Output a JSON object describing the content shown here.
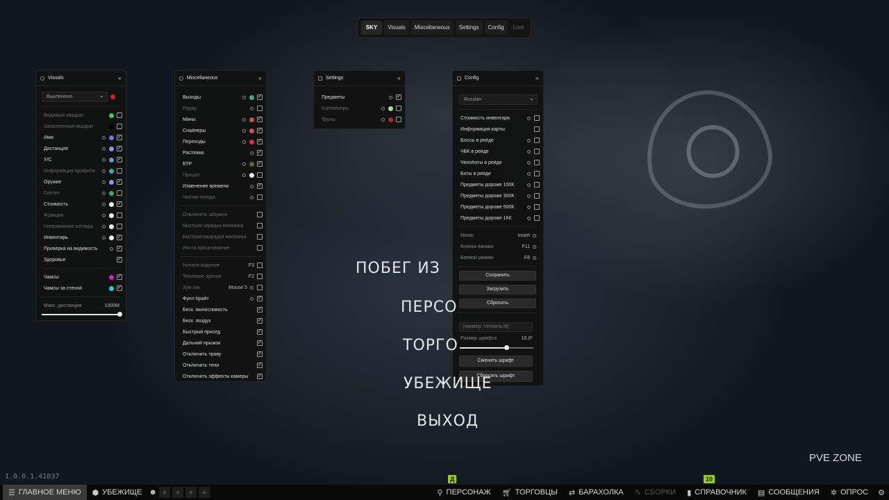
{
  "topnav": {
    "tabs": [
      {
        "label": "SKY"
      },
      {
        "label": "Visuals"
      },
      {
        "label": "Miscellaneous"
      },
      {
        "label": "Settings"
      },
      {
        "label": "Config"
      },
      {
        "label": "Loot"
      }
    ]
  },
  "visuals": {
    "title": "Visuals",
    "close": "×",
    "mode_select": "Выключено",
    "mode_color": "#e02020",
    "rows": [
      {
        "label": "Видимый квадрат",
        "dim": true,
        "color": "#3ccf4e",
        "checked": false
      },
      {
        "label": "Заполненный квадрат",
        "dim": true,
        "color": "#050505",
        "checked": false
      },
      {
        "label": "Имя",
        "dim": false,
        "color": "#7a6cf0",
        "checked": true
      },
      {
        "label": "Дистанция",
        "dim": false,
        "color": "#9a8cf0",
        "checked": true
      },
      {
        "label": "У/С",
        "dim": false,
        "color": "#5a9ae0",
        "checked": true
      },
      {
        "label": "Информация профиля",
        "dim": true,
        "color": "#3aaacc",
        "checked": false
      },
      {
        "label": "Оружие",
        "dim": false,
        "color": "#9a8cf0",
        "checked": true
      },
      {
        "label": "Скелет",
        "dim": true,
        "color": "#3aaa6a",
        "checked": false
      },
      {
        "label": "Стоимость",
        "dim": false,
        "color": "#f0f0f0",
        "checked": true
      },
      {
        "label": "Фракция",
        "dim": true,
        "color": "#f0f0f0",
        "checked": false
      },
      {
        "label": "Направление взгляда",
        "dim": true,
        "color": "#f0f0f0",
        "checked": false
      },
      {
        "label": "Инвентарь",
        "dim": false,
        "color": "#f0f0f0",
        "checked": true
      },
      {
        "label": "Проверка на видимость",
        "dim": false,
        "color": "",
        "checked": true
      },
      {
        "label": "Здоровье",
        "dim": false,
        "color": "",
        "checked": true
      }
    ],
    "rows2": [
      {
        "label": "Чамсы",
        "dim": false,
        "color": "#d020d0",
        "checked": true
      },
      {
        "label": "Чамсы за стеной",
        "dim": false,
        "color": "#20d0e0",
        "checked": true
      }
    ],
    "max_distance_label": "Макс. дистанция",
    "max_distance_value": "1000M",
    "max_distance_fraction": 1.0
  },
  "misc": {
    "title": "Miscellaneous",
    "close": "×",
    "rows": [
      {
        "label": "Выходы",
        "dim": false,
        "color": "#3ab08a",
        "checked": true,
        "key": ""
      },
      {
        "label": "Радар",
        "dim": true,
        "color": "",
        "checked": false,
        "key": ""
      },
      {
        "label": "Мины",
        "dim": false,
        "color": "#d05050",
        "checked": true,
        "key": ""
      },
      {
        "label": "Снайперы",
        "dim": false,
        "color": "#d05060",
        "checked": true,
        "key": ""
      },
      {
        "label": "Переходы",
        "dim": false,
        "color": "#e03040",
        "checked": true,
        "key": ""
      },
      {
        "label": "Растяжки",
        "dim": false,
        "color": "",
        "checked": true,
        "key": ""
      },
      {
        "label": "БТР",
        "dim": false,
        "color": "#5a6a30",
        "checked": true,
        "key": ""
      },
      {
        "label": "Прицел",
        "dim": true,
        "color": "#f8f8f8",
        "checked": false,
        "key": ""
      },
      {
        "label": "Изменение времени",
        "dim": false,
        "color": "",
        "checked": true,
        "key": ""
      },
      {
        "label": "Чистая погода",
        "dim": true,
        "color": "",
        "checked": false,
        "key": ""
      }
    ],
    "rows2": [
      {
        "label": "Отключить забрало",
        "dim": true,
        "checked": false,
        "key": ""
      },
      {
        "label": "Быстрая зарядка магазина",
        "dim": true,
        "checked": false,
        "key": ""
      },
      {
        "label": "Быстрая разрядка магазина",
        "dim": true,
        "checked": false,
        "key": ""
      },
      {
        "label": "Инста прицеливание",
        "dim": true,
        "checked": false,
        "key": ""
      }
    ],
    "rows3": [
      {
        "label": "Ночное видение",
        "dim": true,
        "checked": false,
        "key": "F3",
        "gear": false
      },
      {
        "label": "Тепловое зрение",
        "dim": true,
        "checked": false,
        "key": "F2",
        "gear": false
      },
      {
        "label": "Зум хак",
        "dim": true,
        "checked": false,
        "key": "Mouse 5",
        "gear": true
      },
      {
        "label": "Фулл брайт",
        "dim": false,
        "checked": true,
        "key": "",
        "gear": true
      },
      {
        "label": "Беск. выносливость",
        "dim": false,
        "checked": true,
        "key": "",
        "gear": false
      },
      {
        "label": "Беск. воздух",
        "dim": false,
        "checked": true,
        "key": "",
        "gear": false
      },
      {
        "label": "Быстрый присед",
        "dim": false,
        "checked": true,
        "key": "",
        "gear": false
      },
      {
        "label": "Дальний прыжок",
        "dim": false,
        "checked": true,
        "key": "",
        "gear": false
      },
      {
        "label": "Отключить траву",
        "dim": false,
        "checked": true,
        "key": "",
        "gear": false
      },
      {
        "label": "Отключить тени",
        "dim": false,
        "checked": true,
        "key": "",
        "gear": false
      },
      {
        "label": "Отключить эффекты камеры",
        "dim": false,
        "checked": true,
        "key": "",
        "gear": false
      }
    ]
  },
  "settings": {
    "title": "Settings",
    "close": "×",
    "rows": [
      {
        "label": "Предметы",
        "dim": false,
        "color": "",
        "checked": true
      },
      {
        "label": "Контейнеры",
        "dim": true,
        "color": "#a0e0a0",
        "checked": false
      },
      {
        "label": "Трупы",
        "dim": true,
        "color": "#c02020",
        "checked": false
      }
    ]
  },
  "config": {
    "title": "Config",
    "close": "×",
    "language": "Russian",
    "rows": [
      {
        "label": "Стоимость инвентаря",
        "gear": true,
        "checked": false
      },
      {
        "label": "Информация карты",
        "gear": false,
        "checked": false
      },
      {
        "label": "Боссы в рейде",
        "gear": true,
        "checked": false
      },
      {
        "label": "ЧВК в рейде",
        "gear": true,
        "checked": false
      },
      {
        "label": "Челоботы в рейде",
        "gear": true,
        "checked": false
      },
      {
        "label": "Боты в рейде",
        "gear": true,
        "checked": false
      },
      {
        "label": "Предметы дороже 100К",
        "gear": true,
        "checked": false
      },
      {
        "label": "Предметы дороже 300К",
        "gear": true,
        "checked": false
      },
      {
        "label": "Предметы дороже 500К",
        "gear": true,
        "checked": false
      },
      {
        "label": "Предметы дороже 1КК",
        "gear": true,
        "checked": false
      }
    ],
    "binds": [
      {
        "label": "Меню",
        "key": "Insert"
      },
      {
        "label": "Кнопка паники",
        "key": "F11"
      },
      {
        "label": "Боевой режим",
        "key": "F8"
      }
    ],
    "save": "Сохранить",
    "load": "Загрузить",
    "reset": "Сбросить",
    "font_placeholder": "(пример: Verdana.ttf)",
    "font_size_label": "Размер шрифта",
    "font_size_value": "16.0*",
    "font_size_fraction": 0.64,
    "change_font": "Сменить шрифт",
    "reset_font": "Сбросить шрифт"
  },
  "main_menu": {
    "items": [
      "ПОБЕГ ИЗ",
      "ПЕРСО",
      "ТОРГО",
      "УБЕЖИЩЕ",
      "ВЫХОД"
    ]
  },
  "pve_zone": "PVE ZONE",
  "version": "1.0.0.1.41837",
  "bottombar": {
    "main_menu": "ГЛАВНОЕ МЕНЮ",
    "hideout": "УБЕЖИЩЕ",
    "slot_plus": "+",
    "character": "ПЕРСОНАЖ",
    "traders": "ТОРГОВЦЫ",
    "flea": "БАРАХОЛКА",
    "builds": "СБОРКИ",
    "handbook": "СПРАВОЧНИК",
    "messages": "СООБЩЕНИЯ",
    "survey": "ОПРОС",
    "badge_character": "Д",
    "badge_handbook": "10"
  }
}
